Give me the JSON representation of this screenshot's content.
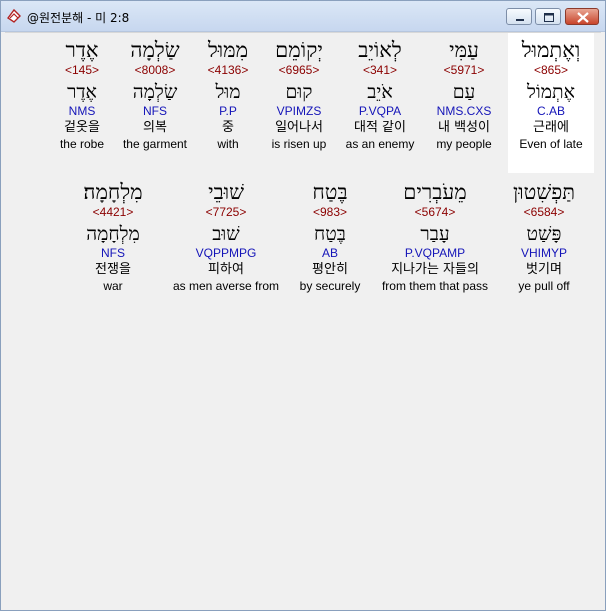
{
  "window": {
    "title": "@원전분해 - 미 2:8",
    "icon": "bible-book-icon",
    "buttons": [
      "minimize-icon",
      "maximize-icon",
      "close-icon"
    ]
  },
  "colors": {
    "strong": "#8b0000",
    "morph": "#1414b8",
    "highlight": "#ffffff"
  },
  "rows": [
    [
      {
        "heb": "וְאֶתְמוּל",
        "strong": "<865>",
        "lemma": "אֶתְמוֹל",
        "morph": "C.AB",
        "korean": "근래에",
        "english": "Even of late"
      },
      {
        "heb": "עַמִּי",
        "strong": "<5971>",
        "lemma": "עַם",
        "morph": "NMS.CXS",
        "korean": "내 백성이",
        "english": "my people"
      },
      {
        "heb": "לְאוֹיֵב",
        "strong": "<341>",
        "lemma": "אֹיֵב",
        "morph": "P.VQPA",
        "korean": "대적 같이",
        "english": "as an enemy"
      },
      {
        "heb": "יְקוֹמֵם",
        "strong": "<6965>",
        "lemma": "קוּם",
        "morph": "VPIMZS",
        "korean": "일어나서",
        "english": "is risen up"
      },
      {
        "heb": "מִמּוּל",
        "strong": "<4136>",
        "lemma": "מוּל",
        "morph": "P.P",
        "korean": "중",
        "english": "with"
      },
      {
        "heb": "שַׂלְמָה",
        "strong": "<8008>",
        "lemma": "שַׂלְמָה",
        "morph": "NFS",
        "korean": "의복",
        "english": "the garment"
      },
      {
        "heb": "אֶדֶר",
        "strong": "<145>",
        "lemma": "אֶדֶר",
        "morph": "NMS",
        "korean": "겉옷을",
        "english": "the robe"
      }
    ],
    [
      {
        "heb": "תַּפְשִׁטוּן",
        "strong": "<6584>",
        "lemma": "פָּשַׁט",
        "morph": "VHIMYP",
        "korean": "벗기며",
        "english": "ye pull off"
      },
      {
        "heb": "מֵעֹבְרִים",
        "strong": "<5674>",
        "lemma": "עָבַר",
        "morph": "P.VQPAMP",
        "korean": "지나가는 자들의",
        "english": "from them that pass"
      },
      {
        "heb": "בֶּטַח",
        "strong": "<983>",
        "lemma": "בֶּטַח",
        "morph": "AB",
        "korean": "평안히",
        "english": "by securely"
      },
      {
        "heb": "שׁוּבֵי",
        "strong": "<7725>",
        "lemma": "שׁוּב",
        "morph": "VQPPMPG",
        "korean": "피하여",
        "english": "as men averse from"
      },
      {
        "heb": "מִלְחָמָה׃",
        "strong": "<4421>",
        "lemma": "מִלְחָמָה",
        "morph": "NFS",
        "korean": "전쟁을",
        "english": "war"
      }
    ]
  ]
}
